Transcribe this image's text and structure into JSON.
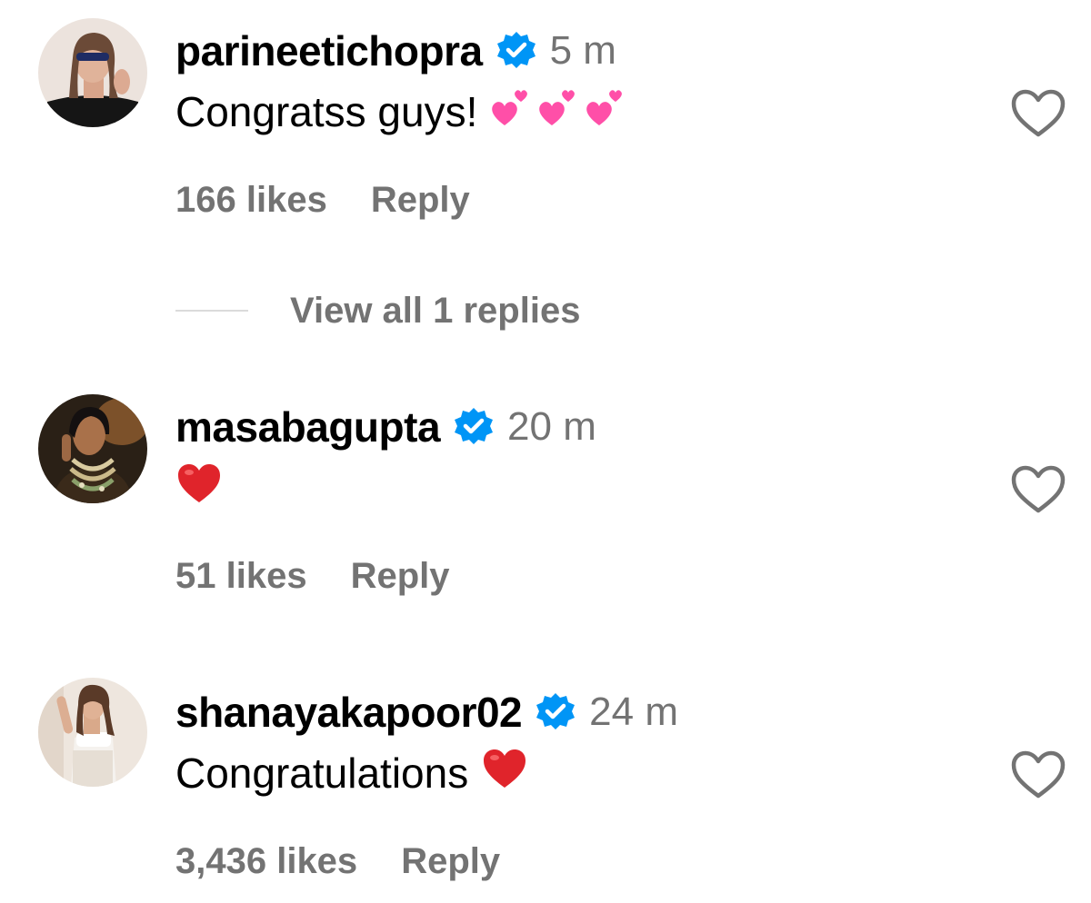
{
  "comments": [
    {
      "username": "parineetichopra",
      "time": "5 m",
      "text": "Congratss guys!",
      "emoji": "revolving-hearts x3",
      "likes": "166 likes",
      "reply_label": "Reply",
      "view_replies_label": "View all 1 replies"
    },
    {
      "username": "masabagupta",
      "time": "20 m",
      "text": "",
      "emoji": "red-heart",
      "likes": "51 likes",
      "reply_label": "Reply"
    },
    {
      "username": "shanayakapoor02",
      "time": "24 m",
      "text": "Congratulations",
      "emoji": "red-heart",
      "likes": "3,436 likes",
      "reply_label": "Reply"
    }
  ],
  "icons": {
    "verified": "verified-badge-icon",
    "like": "heart-outline-icon"
  },
  "colors": {
    "verified_blue": "#0095f6",
    "secondary_text": "#737373",
    "emoji_pink": "#ff4fa8",
    "emoji_red": "#e0242b"
  }
}
